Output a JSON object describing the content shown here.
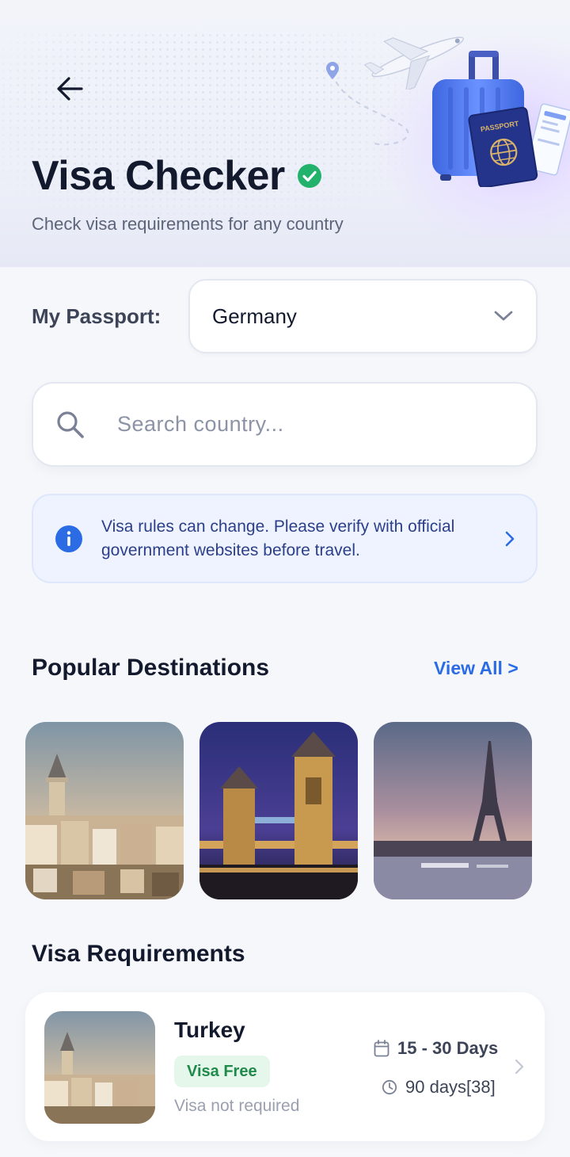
{
  "header": {
    "title": "Visa Checker",
    "subtitle": "Check visa requirements for any country",
    "icons": [
      "back-arrow-icon",
      "verified-check-icon",
      "airplane-icon",
      "suitcase-icon",
      "passport-icon"
    ]
  },
  "passport": {
    "label": "My Passport:",
    "selected": "Germany"
  },
  "search": {
    "placeholder": "Search country..."
  },
  "notice": {
    "text": "Visa rules can change. Please verify with official government websites before travel."
  },
  "popular": {
    "title": "Popular Destinations",
    "view_all": "View All >",
    "items": [
      {
        "name": "istanbul-galata-tower"
      },
      {
        "name": "london-tower-bridge"
      },
      {
        "name": "paris-eiffel-tower"
      }
    ]
  },
  "requirements": {
    "title": "Visa Requirements",
    "items": [
      {
        "country": "Turkey",
        "badge": "Visa Free",
        "note": "Visa not required",
        "stay": "15 - 30 Days",
        "validity": "90 days[38]"
      }
    ]
  },
  "colors": {
    "accent": "#2b6be4",
    "success": "#22b26b",
    "badge_bg": "#e5f6ea",
    "badge_text": "#1f8a4a",
    "notice_bg": "#eef3ff",
    "title": "#141a2e"
  }
}
